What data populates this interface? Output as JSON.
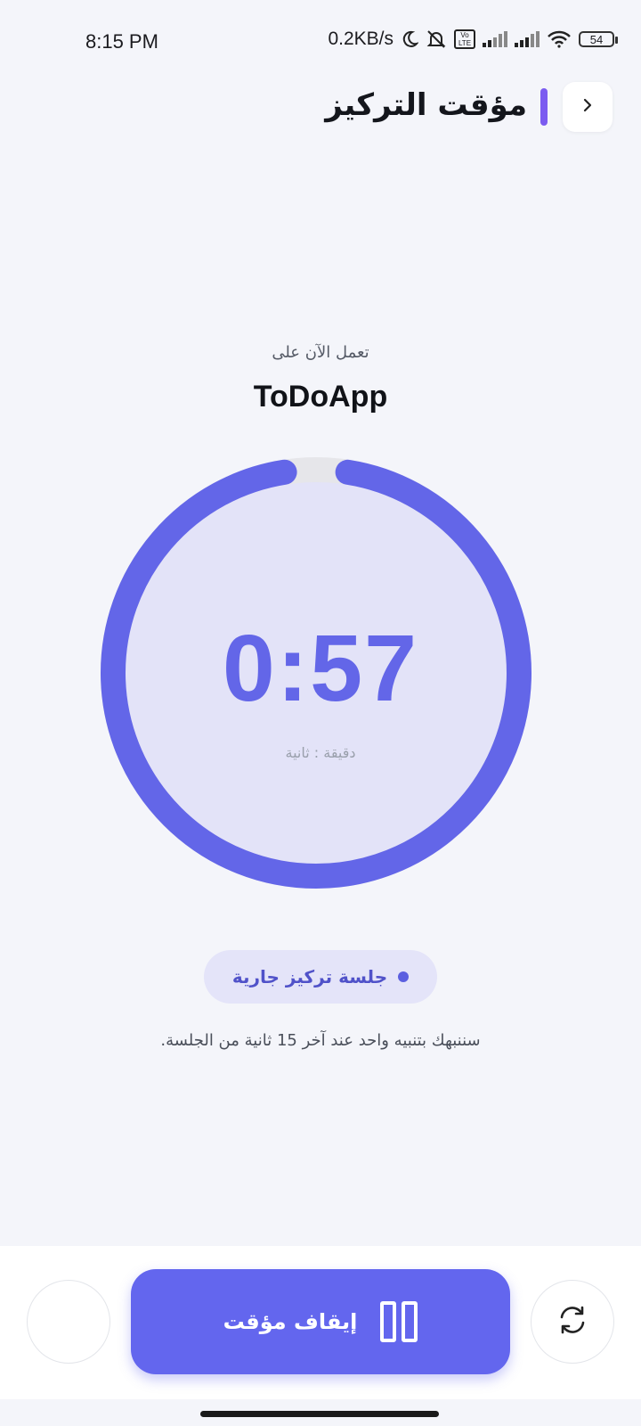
{
  "status_bar": {
    "time": "8:15 PM",
    "network_speed": "0.2KB/s",
    "battery": "54",
    "volte": "Vo LTE",
    "icons": [
      "moon-icon",
      "bell-off-icon",
      "volte-icon",
      "signal-icon",
      "signal-icon",
      "wifi-icon",
      "battery-icon"
    ]
  },
  "header": {
    "title": "مؤقت التركيز",
    "accent_color": "#7b5cf0",
    "back_icon": "chevron-right-icon"
  },
  "focus": {
    "working_on_label": "تعمل الآن على",
    "project_name": "ToDoApp"
  },
  "timer": {
    "value": "0:57",
    "unit_label": "دقيقة : ثانية",
    "progress_fraction": 0.95,
    "ring_color": "#6366e8",
    "track_color": "#e6e6ea",
    "face_color": "#e3e3f8"
  },
  "session": {
    "badge_label": "جلسة تركيز جارية",
    "note": "سننبهك بتنبيه واحد عند آخر 15 ثانية من الجلسة."
  },
  "controls": {
    "pause_label": "إيقاف مؤقت",
    "pause_icon": "pause-icon",
    "reset_icon": "refresh-icon"
  }
}
